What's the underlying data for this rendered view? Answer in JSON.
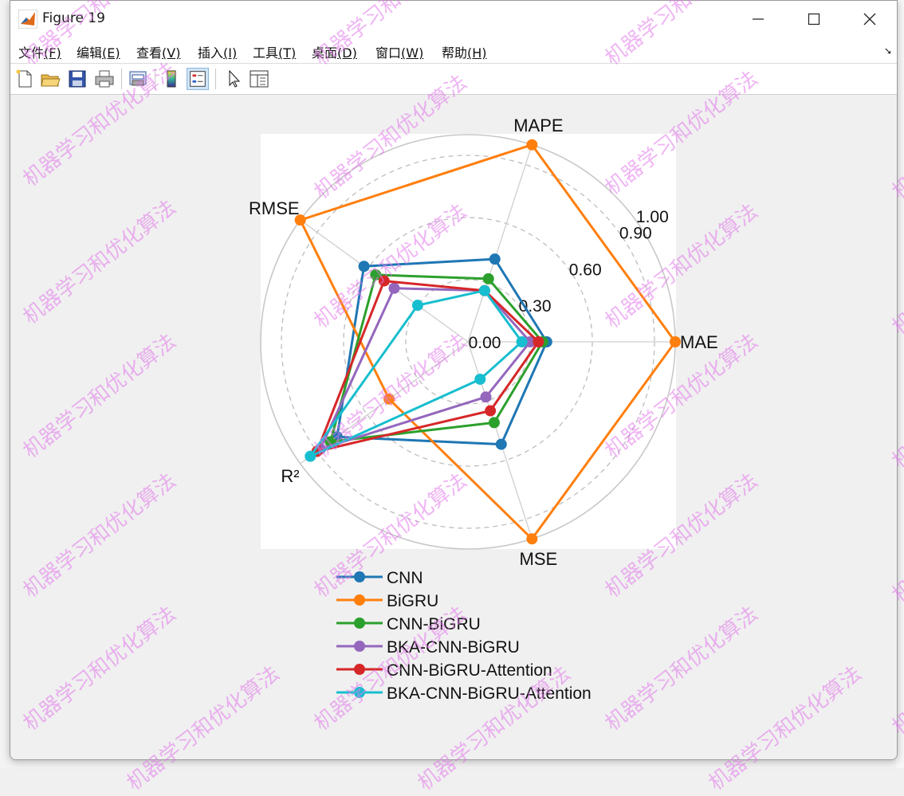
{
  "window": {
    "title": "Figure 19",
    "menus": [
      {
        "label": "文件",
        "key": "(F)"
      },
      {
        "label": "编辑",
        "key": "(E)"
      },
      {
        "label": "查看",
        "key": "(V)"
      },
      {
        "label": "插入",
        "key": "(I)"
      },
      {
        "label": "工具",
        "key": "(T)"
      },
      {
        "label": "桌面",
        "key": "(D)"
      },
      {
        "label": "窗口",
        "key": "(W)"
      },
      {
        "label": "帮助",
        "key": "(H)"
      }
    ],
    "toolbar_icons": [
      "new-figure-icon",
      "open-file-icon",
      "save-icon",
      "print-icon",
      "print-preview-icon",
      "colorbar-icon",
      "legend-icon",
      "pointer-icon",
      "property-inspector-icon"
    ]
  },
  "watermark_text": "机器学习和优化算法",
  "chart_data": {
    "type": "radar",
    "axes": [
      "MAE",
      "MAPE",
      "RMSE",
      "R²",
      "MSE"
    ],
    "rlim": [
      0,
      1
    ],
    "radial_tick_labels": [
      "0.00",
      "0.30",
      "0.60",
      "0.90",
      "1.00"
    ],
    "radial_ticks": [
      0.0,
      0.3,
      0.6,
      0.9,
      1.0
    ],
    "grid": true,
    "legend_position": "bottom",
    "series": [
      {
        "name": "CNN",
        "color": "#1f77b4",
        "values": [
          0.38,
          0.42,
          0.62,
          0.78,
          0.52
        ]
      },
      {
        "name": "BiGRU",
        "color": "#ff7f0e",
        "values": [
          1.0,
          1.0,
          1.0,
          0.47,
          1.0
        ]
      },
      {
        "name": "CNN-BiGRU",
        "color": "#2ca02c",
        "values": [
          0.36,
          0.32,
          0.55,
          0.82,
          0.41
        ]
      },
      {
        "name": "BKA-CNN-BiGRU",
        "color": "#9467bd",
        "values": [
          0.3,
          0.26,
          0.44,
          0.88,
          0.28
        ]
      },
      {
        "name": "CNN-BiGRU-Attention",
        "color": "#d62728",
        "values": [
          0.34,
          0.26,
          0.5,
          0.9,
          0.35
        ]
      },
      {
        "name": "BKA-CNN-BiGRU-Attention",
        "color": "#17becf",
        "values": [
          0.26,
          0.26,
          0.3,
          0.94,
          0.19
        ]
      }
    ]
  }
}
